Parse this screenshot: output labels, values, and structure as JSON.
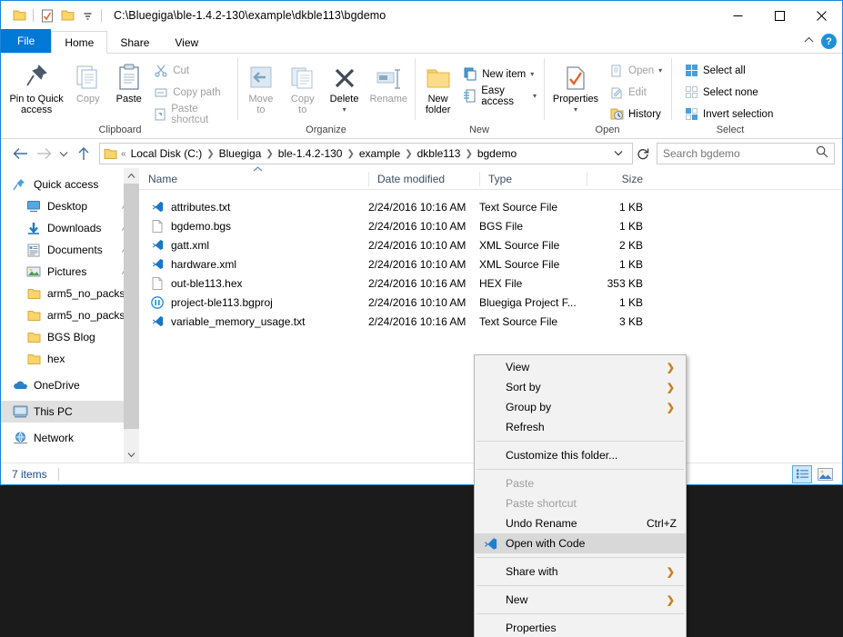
{
  "window": {
    "title": "C:\\Bluegiga\\ble-1.4.2-130\\example\\dkble113\\bgdemo",
    "quick_access_icons": [
      "folder-icon",
      "properties-check-icon",
      "new-folder-icon",
      "customize-qat-caret-icon"
    ],
    "controls": {
      "minimize": "—",
      "maximize": "□",
      "close": "✕"
    }
  },
  "tabs": {
    "file": "File",
    "items": [
      {
        "label": "Home",
        "active": true
      },
      {
        "label": "Share",
        "active": false
      },
      {
        "label": "View",
        "active": false
      }
    ],
    "collapse_label": "^",
    "help_label": "?"
  },
  "ribbon": {
    "groups": [
      {
        "label": "Clipboard",
        "big": [
          {
            "label": "Pin to Quick\naccess",
            "icon": "pin-icon",
            "dim": false
          },
          {
            "label": "Copy",
            "icon": "copy-icon",
            "dim": true
          },
          {
            "label": "Paste",
            "icon": "paste-icon",
            "dim": false
          }
        ],
        "small": [
          {
            "label": "Cut",
            "icon": "scissors-icon",
            "dim": true
          },
          {
            "label": "Copy path",
            "icon": "copy-path-icon",
            "dim": true
          },
          {
            "label": "Paste shortcut",
            "icon": "paste-shortcut-icon",
            "dim": true
          }
        ]
      },
      {
        "label": "Organize",
        "big": [
          {
            "label": "Move\nto",
            "icon": "move-to-icon",
            "dim": true,
            "caret": true
          },
          {
            "label": "Copy\nto",
            "icon": "copy-to-icon",
            "dim": true,
            "caret": true
          },
          {
            "label": "Delete",
            "icon": "delete-x-icon",
            "dim": false,
            "caret": true
          },
          {
            "label": "Rename",
            "icon": "rename-icon",
            "dim": true
          }
        ],
        "small": []
      },
      {
        "label": "New",
        "big": [
          {
            "label": "New\nfolder",
            "icon": "new-folder-icon",
            "dim": false
          }
        ],
        "small": [
          {
            "label": "New item",
            "icon": "new-item-icon",
            "dim": false,
            "caret": true
          },
          {
            "label": "Easy access",
            "icon": "easy-access-icon",
            "dim": false,
            "caret": true
          }
        ]
      },
      {
        "label": "Open",
        "big": [
          {
            "label": "Properties",
            "icon": "properties-icon",
            "dim": false,
            "caret": true
          }
        ],
        "small": [
          {
            "label": "Open",
            "icon": "open-icon",
            "dim": true,
            "caret": true
          },
          {
            "label": "Edit",
            "icon": "edit-icon",
            "dim": true
          },
          {
            "label": "History",
            "icon": "history-icon",
            "dim": false
          }
        ]
      },
      {
        "label": "Select",
        "big": [],
        "small": [
          {
            "label": "Select all",
            "icon": "select-all-icon",
            "dim": false
          },
          {
            "label": "Select none",
            "icon": "select-none-icon",
            "dim": false
          },
          {
            "label": "Invert selection",
            "icon": "invert-selection-icon",
            "dim": false
          }
        ]
      }
    ]
  },
  "addressbar": {
    "back_icon": "arrow-left-icon",
    "forward_icon": "arrow-right-icon",
    "recent_icon": "chevron-down-icon",
    "up_icon": "arrow-up-icon",
    "folder_icon": "folder-icon",
    "overflow": "«",
    "crumbs": [
      "Local Disk (C:)",
      "Bluegiga",
      "ble-1.4.2-130",
      "example",
      "dkble113",
      "bgdemo"
    ],
    "dropdown_icon": "chevron-down-icon",
    "refresh_icon": "refresh-icon"
  },
  "search": {
    "placeholder": "Search bgdemo",
    "icon": "search-icon"
  },
  "navpane": {
    "items": [
      {
        "label": "Quick access",
        "icon": "quick-access-star-icon",
        "level": 0,
        "pinned": false,
        "selected": false
      },
      {
        "label": "Desktop",
        "icon": "desktop-icon",
        "level": 1,
        "pinned": true,
        "selected": false
      },
      {
        "label": "Downloads",
        "icon": "downloads-icon",
        "level": 1,
        "pinned": true,
        "selected": false
      },
      {
        "label": "Documents",
        "icon": "documents-icon",
        "level": 1,
        "pinned": true,
        "selected": false
      },
      {
        "label": "Pictures",
        "icon": "pictures-icon",
        "level": 1,
        "pinned": true,
        "selected": false
      },
      {
        "label": "arm5_no_packs",
        "icon": "folder-icon",
        "level": 1,
        "pinned": false,
        "selected": false
      },
      {
        "label": "arm5_no_packs",
        "icon": "folder-icon",
        "level": 1,
        "pinned": false,
        "selected": false
      },
      {
        "label": "BGS Blog",
        "icon": "folder-icon",
        "level": 1,
        "pinned": false,
        "selected": false
      },
      {
        "label": "hex",
        "icon": "folder-icon",
        "level": 1,
        "pinned": false,
        "selected": false
      },
      {
        "label": "OneDrive",
        "icon": "onedrive-cloud-icon",
        "level": 0,
        "pinned": false,
        "selected": false
      },
      {
        "label": "This PC",
        "icon": "this-pc-icon",
        "level": 0,
        "pinned": false,
        "selected": true
      },
      {
        "label": "Network",
        "icon": "network-icon",
        "level": 0,
        "pinned": false,
        "selected": false
      }
    ],
    "scroll_up_icon": "chevron-up-icon",
    "scroll_down_icon": "chevron-down-icon"
  },
  "filelist": {
    "columns": [
      "Name",
      "Date modified",
      "Type",
      "Size"
    ],
    "sort_column": "Name",
    "sort_direction": "ascending",
    "rows": [
      {
        "name": "attributes.txt",
        "icon": "vscode-file-icon",
        "date": "2/24/2016 10:16 AM",
        "type": "Text Source File",
        "size": "1 KB"
      },
      {
        "name": "bgdemo.bgs",
        "icon": "blank-file-icon",
        "date": "2/24/2016 10:10 AM",
        "type": "BGS File",
        "size": "1 KB"
      },
      {
        "name": "gatt.xml",
        "icon": "vscode-file-icon",
        "date": "2/24/2016 10:10 AM",
        "type": "XML Source File",
        "size": "2 KB"
      },
      {
        "name": "hardware.xml",
        "icon": "vscode-file-icon",
        "date": "2/24/2016 10:10 AM",
        "type": "XML Source File",
        "size": "1 KB"
      },
      {
        "name": "out-ble113.hex",
        "icon": "blank-file-icon",
        "date": "2/24/2016 10:16 AM",
        "type": "HEX File",
        "size": "353 KB"
      },
      {
        "name": "project-ble113.bgproj",
        "icon": "bluegiga-project-icon",
        "date": "2/24/2016 10:10 AM",
        "type": "Bluegiga Project F...",
        "size": "1 KB"
      },
      {
        "name": "variable_memory_usage.txt",
        "icon": "vscode-file-icon",
        "date": "2/24/2016 10:16 AM",
        "type": "Text Source File",
        "size": "3 KB"
      }
    ]
  },
  "statusbar": {
    "count": "7 items",
    "view_buttons": [
      {
        "name": "details-view-button",
        "icon": "details-view-icon",
        "active": true
      },
      {
        "name": "large-icons-view-button",
        "icon": "large-icons-view-icon",
        "active": false
      }
    ]
  },
  "contextmenu": {
    "items": [
      {
        "label": "View",
        "submenu": true,
        "disabled": false,
        "highlight": false,
        "accel": "",
        "icon": ""
      },
      {
        "label": "Sort by",
        "submenu": true,
        "disabled": false,
        "highlight": false,
        "accel": "",
        "icon": ""
      },
      {
        "label": "Group by",
        "submenu": true,
        "disabled": false,
        "highlight": false,
        "accel": "",
        "icon": ""
      },
      {
        "label": "Refresh",
        "submenu": false,
        "disabled": false,
        "highlight": false,
        "accel": "",
        "icon": ""
      },
      {
        "separator": true
      },
      {
        "label": "Customize this folder...",
        "submenu": false,
        "disabled": false,
        "highlight": false,
        "accel": "",
        "icon": ""
      },
      {
        "separator": true
      },
      {
        "label": "Paste",
        "submenu": false,
        "disabled": true,
        "highlight": false,
        "accel": "",
        "icon": ""
      },
      {
        "label": "Paste shortcut",
        "submenu": false,
        "disabled": true,
        "highlight": false,
        "accel": "",
        "icon": ""
      },
      {
        "label": "Undo Rename",
        "submenu": false,
        "disabled": false,
        "highlight": false,
        "accel": "Ctrl+Z",
        "icon": ""
      },
      {
        "label": "Open with Code",
        "submenu": false,
        "disabled": false,
        "highlight": true,
        "accel": "",
        "icon": "vscode-icon"
      },
      {
        "separator": true
      },
      {
        "label": "Share with",
        "submenu": true,
        "disabled": false,
        "highlight": false,
        "accel": "",
        "icon": ""
      },
      {
        "separator": true
      },
      {
        "label": "New",
        "submenu": true,
        "disabled": false,
        "highlight": false,
        "accel": "",
        "icon": ""
      },
      {
        "separator": true
      },
      {
        "label": "Properties",
        "submenu": false,
        "disabled": false,
        "highlight": false,
        "accel": "",
        "icon": ""
      }
    ]
  },
  "colors": {
    "accent": "#0078d7",
    "window_border": "#1986d8",
    "selection": "#cce8ff",
    "desktop_background": "#1b1b1b",
    "menu_background": "#f2f2f2",
    "menu_highlight": "#d8d8d8",
    "submenu_arrow": "#c87f1c",
    "folder_yellow": "#fcd670",
    "vscode_blue": "#1976c8"
  }
}
